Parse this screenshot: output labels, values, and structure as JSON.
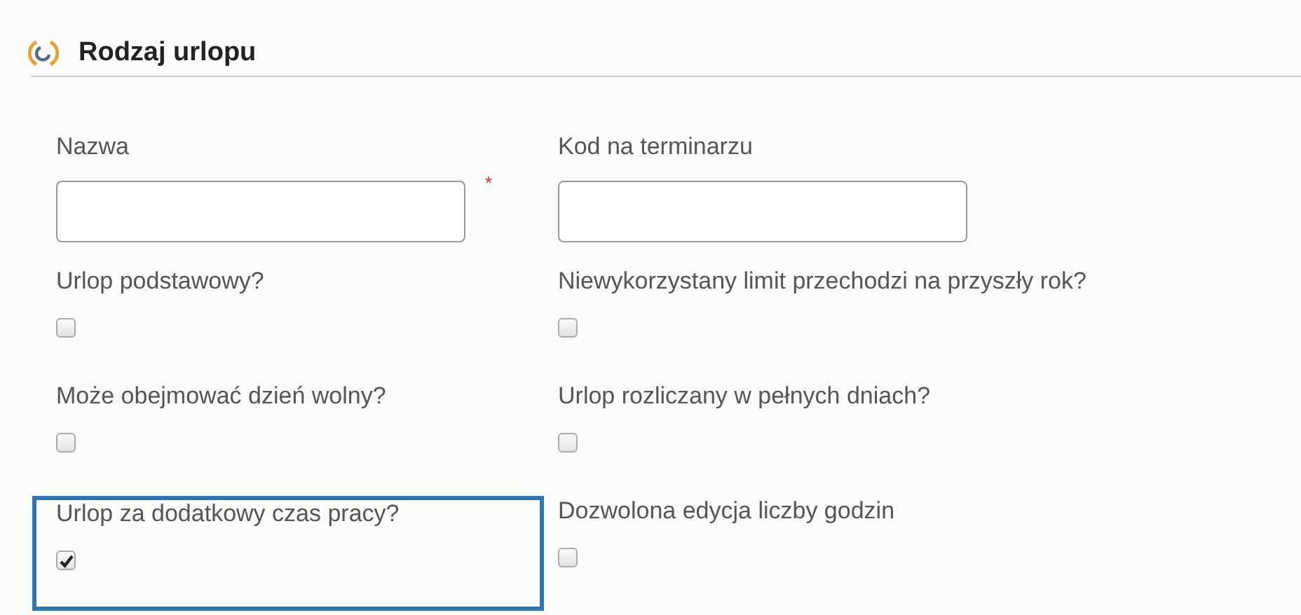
{
  "section": {
    "title": "Rodzaj urlopu"
  },
  "text_fields": [
    {
      "label": "Nazwa",
      "required_mark": "*"
    },
    {
      "label": "Kod na terminarzu"
    }
  ],
  "checkboxes": [
    {
      "label": "Urlop podstawowy?",
      "checked": false,
      "highlighted": false
    },
    {
      "label": "Niewykorzystany limit przechodzi na przyszły rok?",
      "checked": false,
      "highlighted": false
    },
    {
      "label": "Może obejmować dzień wolny?",
      "checked": false,
      "highlighted": false
    },
    {
      "label": "Urlop rozliczany w pełnych dniach?",
      "checked": false,
      "highlighted": false
    },
    {
      "label": "Urlop za dodatkowy czas pracy?",
      "checked": true,
      "highlighted": true
    },
    {
      "label": "Dozwolona edycja liczby godzin",
      "checked": false,
      "highlighted": false
    }
  ]
}
